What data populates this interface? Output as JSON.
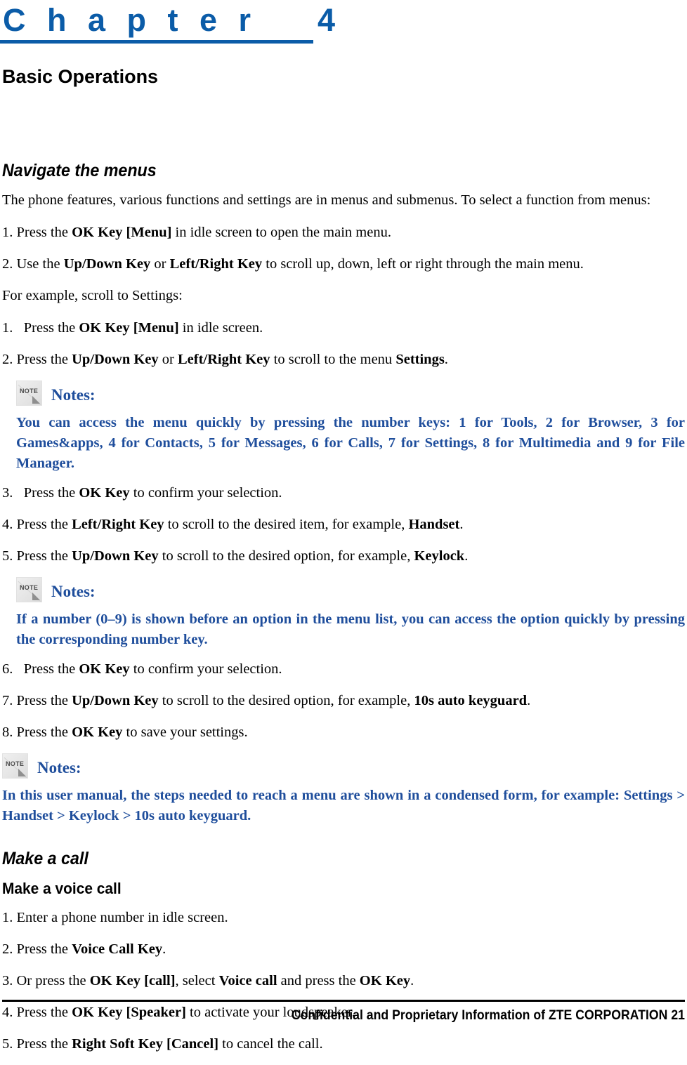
{
  "colors": {
    "chapter_blue": "#0B5CA8",
    "note_blue": "#1F4E9C",
    "text_black": "#000000",
    "note_icon_gray": "#E7E7E7"
  },
  "chapter": {
    "label": "C h a p t e r    4",
    "number": "4",
    "title": "Basic Operations"
  },
  "sections": [
    {
      "heading": "Navigate the menus",
      "intro": "The phone features, various functions and settings are in menus and submenus. To select a function from menus:",
      "steps_a": [
        {
          "num": "1.",
          "text_prefix": "Press the ",
          "bold1": "OK Key [Menu]",
          "text_suffix": " in idle screen to open the main menu."
        },
        {
          "num": "2.",
          "text_prefix": "Use the ",
          "bold1": "Up/Down Key",
          "mid": " or ",
          "bold2": "Left/Right Key",
          "text_suffix": " to scroll up, down, left or right through the main menu."
        }
      ],
      "example_lead": "For example, scroll to Settings:",
      "steps_b": [
        {
          "num": "1.",
          "spaced": true,
          "text_prefix": "Press the ",
          "bold1": "OK Key [Menu]",
          "text_suffix": " in idle screen."
        },
        {
          "num": "2.",
          "spaced": false,
          "text_prefix": "Press the ",
          "bold1": "Up/Down Key",
          "mid": " or ",
          "bold2": "Left/Right Key",
          "text_mid2": " to scroll to the menu ",
          "bold3": "Settings",
          "text_suffix": "."
        }
      ],
      "note1": {
        "icon_name": "note-icon",
        "icon_text": "NOTE",
        "label": "Notes:",
        "body": "You can access the menu quickly by pressing the number keys: 1 for Tools, 2 for Browser, 3 for Games&apps, 4 for Contacts, 5 for Messages, 6 for Calls, 7 for Settings, 8 for Multimedia and 9 for File Manager."
      },
      "steps_c": [
        {
          "num": "3.",
          "spaced": true,
          "text_prefix": "Press the ",
          "bold1": "OK Key",
          "text_suffix": " to confirm your selection."
        },
        {
          "num": "4.",
          "spaced": false,
          "text_prefix": "Press the ",
          "bold1": "Left/Right Key",
          "text_mid2": " to scroll to the desired item, for example, ",
          "bold3": "Handset",
          "text_suffix": "."
        },
        {
          "num": "5.",
          "spaced": false,
          "text_prefix": "Press the ",
          "bold1": "Up/Down Key",
          "text_mid2": " to scroll to the desired option, for example, ",
          "bold3": "Keylock",
          "text_suffix": "."
        }
      ],
      "note2": {
        "icon_name": "note-icon",
        "icon_text": "NOTE",
        "label": "Notes:",
        "body": "If a number (0–9) is shown before an option in the menu list, you can access the option quickly by pressing the corresponding number key."
      },
      "steps_d": [
        {
          "num": "6.",
          "spaced": true,
          "text_prefix": "Press the ",
          "bold1": "OK Key",
          "text_suffix": " to confirm your selection."
        },
        {
          "num": "7.",
          "spaced": false,
          "text_prefix": "Press the ",
          "bold1": "Up/Down Key",
          "text_mid2": " to scroll to the desired option, for example, ",
          "bold3": "10s auto keyguard",
          "text_suffix": "."
        },
        {
          "num": "8.",
          "spaced": false,
          "text_prefix": "Press the ",
          "bold1": "OK Key",
          "text_suffix": " to save your settings."
        }
      ],
      "note3": {
        "icon_name": "note-icon",
        "icon_text": "NOTE",
        "label": "Notes:",
        "body": "In this user manual, the steps needed to reach a menu are shown in a condensed form, for example: Settings > Handset > Keylock > 10s auto keyguard."
      }
    },
    {
      "heading": "Make a call",
      "subheading": "Make a voice call",
      "steps": [
        {
          "num": "1.",
          "text_prefix": "Enter a phone number in idle screen."
        },
        {
          "num": "2.",
          "text_prefix": "Press the ",
          "bold1": "Voice Call Key",
          "text_suffix": "."
        },
        {
          "num": "3.",
          "text_prefix": "Or press the ",
          "bold1": "OK Key [call]",
          "text_mid2": ", select ",
          "bold3": "Voice call",
          "text_mid3": " and press the ",
          "bold4": "OK Key",
          "text_suffix": "."
        },
        {
          "num": "4.",
          "text_prefix": "Press the ",
          "bold1": "OK Key [Speaker]",
          "text_suffix": " to activate your loudspeaker."
        },
        {
          "num": "5.",
          "text_prefix": "Press the ",
          "bold1": "Right Soft Key [Cancel]",
          "text_suffix": " to cancel the call."
        }
      ]
    }
  ],
  "footer": {
    "text": "Confidential and Proprietary Information of ZTE CORPORATION 21",
    "page_number": "21"
  }
}
